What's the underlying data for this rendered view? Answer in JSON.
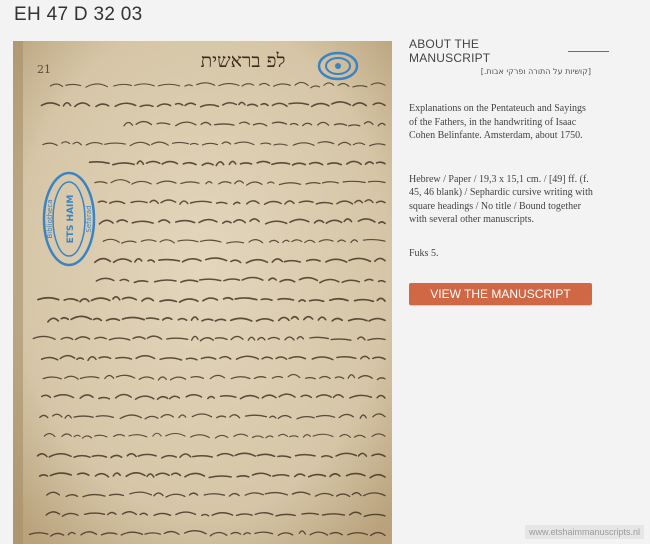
{
  "page": {
    "title": "EH 47 D 32 03"
  },
  "manuscript_image": {
    "hebrew_header": "לפ בראשית",
    "stamp_lines": [
      "Bibliotheca",
      "ETS HAIM",
      "Sefarad"
    ],
    "folio_mark": "21"
  },
  "info": {
    "heading": "ABOUT THE MANUSCRIPT",
    "hebrew_subtitle": "[קושיות על התורה ופרקי אבות.]",
    "description": "Explanations on the Pentateuch and Sayings of the Fathers, in the handwriting of Isaac Cohen Belinfante. Amsterdam, about 1750.",
    "physical": "Hebrew / Paper / 19,3 x 15,1 cm. / [49] ff. (f. 45, 46 blank) / Sephardic cursive writing with square headings / No title / Bound together with several other manuscripts.",
    "reference": "Fuks 5."
  },
  "button": {
    "label": "VIEW THE MANUSCRIPT"
  },
  "footer": {
    "url": "www.etshaimmanuscripts.nl"
  },
  "colors": {
    "accent": "#d06845",
    "rule": "#4a7f73",
    "stamp": "#3a83c4",
    "ink": "#3b2a1c",
    "paper": "#d9cbb0"
  }
}
